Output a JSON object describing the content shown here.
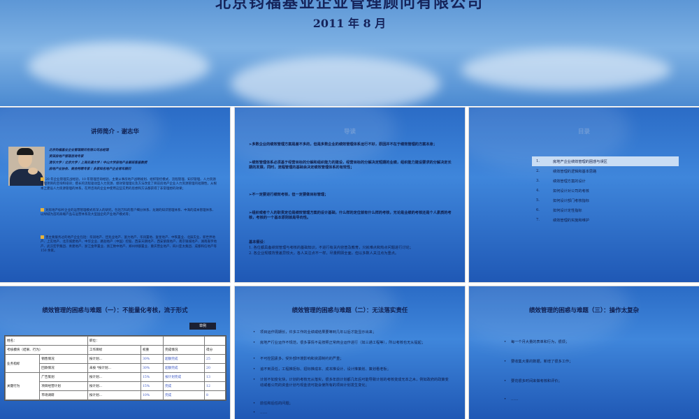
{
  "cover": {
    "company": "北京钧福基业企业管理顾问有限公司",
    "date": "2011 年 8 月"
  },
  "slide1": {
    "title": "讲师简介 - 谢志华",
    "bio_lines": [
      "北京钧福基业企业管理顾问有限公司总经理",
      "资深房地产管理咨询专家",
      "清华大学 / 北京大学 / 上海交通大学 / 中山大学房地产总裁班客座教授",
      "房地产业协会、商会特聘专家 / 多家知名地产企业常年顾问"
    ],
    "paragraphs": [
      "20 年企业管理实战经验，10 年管理咨询经验，主要从事房地产战略规划、组织管控模式、流程管理、知识管理、人力资源管理项目的咨询和培训；擅长的流程驱动型人力资源、绩效管理理论及方法改变了目前房地产企业人力资源管理的短期性，从根本上建设人力资源管理的体系，在所咨询的企业中使用这些实用的思想和方法都获得了非常理想的效果；",
      "对房地产标杆企业的运营管理模式有深入的研究，包括万科的客户细分体系、龙湖的知识管理体系、中海的成本管理体系、以绿城为首的高端产品与运营体系及大型国企的产业地产模式等；",
      "曾主要服务过的地产企业包括：华润地产、佳兆业地产、富力地产、华润置地、复星地产、中铁置业、北辰实业、新世界地产、上实地产、北京城建地产、中华企业、路劲地产（中国）控股、西安天朗地产、西安紫薇地产、南京银城地产、湖南嘉宇地产、武汉宏宇集团、青建地产、浙江金帝置业、浙江致中地产、郑州绿都置业、重庆营业地产、四川亚太集团、成都和信地产等 150 余家。"
    ]
  },
  "slide2": {
    "title": "导读",
    "paragraphs": [
      "➢多数企业的绩效管理方案是差不多的，但是多数企业的绩效管理体系运行不好，原因并不在于绩效管理的方案本身；",
      "➢绩效管理体系必须基于经营目标的分解和组织能力的建设，经营目标的分解决定短期的业绩，组织能力建设要求的分解决定长期的发展，同时，流程管理的基础会决定绩效管理体系的有效性；",
      "➢不一定要进行绩效考核，但一定要做目标管理；",
      "➢组织或者个人的职责定位是绩效管理方案的设计基础，什么样的定位就有什么样的考核，无论是业绩的考核还是个人素质的考核，考核的一个基本原则就是导向性。"
    ],
    "basics_title": "基本假设：",
    "basics": [
      "1. 各位都具备绩效管理与考核的基础知识，不进行有关内容普及教育，只就难点和热点问题进行讨论；",
      "2. 各企业规模背景差异较大，各人关注点不一样，尽量照顾全面，但以多数人关注点为重点。"
    ]
  },
  "slide3": {
    "title": "目录",
    "items": [
      {
        "num": "1.",
        "label": "房地产企业绩效管理的困惑与误区"
      },
      {
        "num": "2.",
        "label": "绩效管理的逻辑和基本思路"
      },
      {
        "num": "3.",
        "label": "绩效管理方案的设计"
      },
      {
        "num": "4.",
        "label": "如何设计对公司的考核"
      },
      {
        "num": "5.",
        "label": "如何设计部门考核指标"
      },
      {
        "num": "6.",
        "label": "如何设计定性指标"
      },
      {
        "num": "7.",
        "label": "绩效管理的实施和维护"
      }
    ]
  },
  "slide4": {
    "title": "绩效管理的困惑与难题（一）：不能量化考核，流于形式",
    "tag": "举例",
    "form": {
      "name_label": "姓名：",
      "post_label": "职位：",
      "header": [
        "考核模块（结果、行为）",
        "工作目标",
        "权重",
        "完成情况",
        "得分"
      ],
      "side1": "业务指标",
      "side2": "关键行为",
      "rows": [
        [
          "销售情况",
          "按计划...",
          "30%",
          "超额完成",
          "25"
        ],
        [
          "回款情况",
          "未按 *按计划...",
          "30%",
          "超额完成",
          "20"
        ],
        [
          "广告策划",
          "按计划...",
          "15%",
          "按计划完成",
          "13"
        ],
        [
          "项目经营计划",
          "按计划...",
          "15%",
          "完成",
          "12"
        ],
        [
          "市场调研",
          "按计划...",
          "10%",
          "完成",
          "8"
        ]
      ]
    }
  },
  "slide5": {
    "title": "绩效管理的困惑与难题（二）：无法落实责任",
    "bullets": [
      "项目运作周期长，许多工作的业绩或结果要等到几年以后才能显示出来；",
      "房地产行业运作不规范，很多事情不是按照正常商业运作进行（如三通工程等），所以考核也无从提起；",
      "不可控因素多，受外部环境影响和资源制约的严重；",
      "追不到责任，工程推拒标、招标推成本、成本推设计、设计推策划、策划看老板；",
      "计划不如变化快，计划的考核无从落实，很多年前计划都几年后可能导致计划的考核变成无本之木，例如政府的政策变动或者公司的资金计划与现金流可能会使所有的项目计划发生变化；",
      "前任和后任的问题；",
      "……"
    ]
  },
  "slide6": {
    "title": "绩效管理的困惑与难题（三）：操作太复杂",
    "bullets": [
      "每一个月大量的表单和行为，很烦；",
      "要收集大量的数据，新增了很多工作；",
      "要花很多时间来做考核和评价；",
      "……"
    ]
  }
}
